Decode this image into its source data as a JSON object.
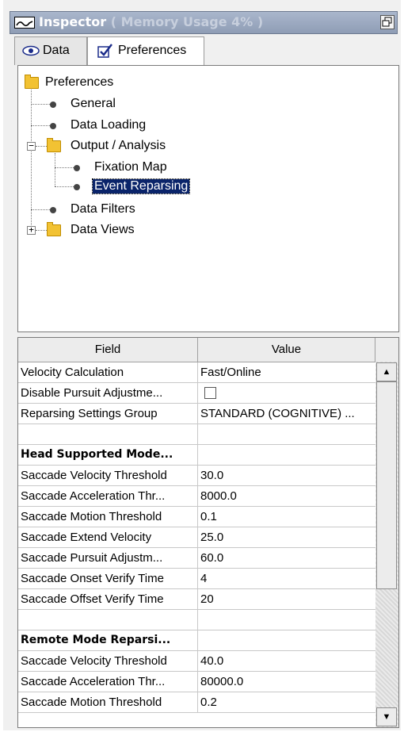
{
  "window": {
    "title": "Inspector",
    "title_suffix": " ( Memory Usage 4% )"
  },
  "tabs": [
    {
      "label": "Data",
      "icon": "eye-icon",
      "active": false
    },
    {
      "label": "Preferences",
      "icon": "checkbox-icon",
      "active": true
    }
  ],
  "tree": {
    "root": "Preferences",
    "items": {
      "general": "General",
      "data_loading": "Data Loading",
      "output_analysis": "Output / Analysis",
      "fixation_map": "Fixation Map",
      "event_reparsing": "Event Reparsing",
      "data_filters": "Data Filters",
      "data_views": "Data Views"
    },
    "selected": "Event Reparsing"
  },
  "grid": {
    "headers": {
      "field": "Field",
      "value": "Value"
    },
    "rows": [
      {
        "field": "Velocity Calculation",
        "value": "Fast/Online"
      },
      {
        "field": "Disable Pursuit Adjustme...",
        "value": "",
        "checkbox": true
      },
      {
        "field": "Reparsing Settings Group",
        "value": "STANDARD (COGNITIVE) ..."
      },
      {
        "field": "",
        "value": ""
      },
      {
        "field": "Head Supported Mode...",
        "value": "",
        "group": true
      },
      {
        "field": "Saccade Velocity Threshold",
        "value": "30.0"
      },
      {
        "field": "Saccade Acceleration Thr...",
        "value": "8000.0"
      },
      {
        "field": "Saccade Motion Threshold",
        "value": "0.1"
      },
      {
        "field": "Saccade Extend Velocity",
        "value": "25.0"
      },
      {
        "field": "Saccade Pursuit Adjustm...",
        "value": "60.0"
      },
      {
        "field": "Saccade Onset Verify Time",
        "value": "4"
      },
      {
        "field": "Saccade Offset Verify Time",
        "value": "20"
      },
      {
        "field": "",
        "value": ""
      },
      {
        "field": "Remote Mode Reparsi...",
        "value": "",
        "group": true
      },
      {
        "field": "Saccade Velocity Threshold",
        "value": "40.0"
      },
      {
        "field": "Saccade Acceleration Thr...",
        "value": "80000.0"
      },
      {
        "field": "Saccade Motion Threshold",
        "value": "0.2"
      }
    ]
  }
}
